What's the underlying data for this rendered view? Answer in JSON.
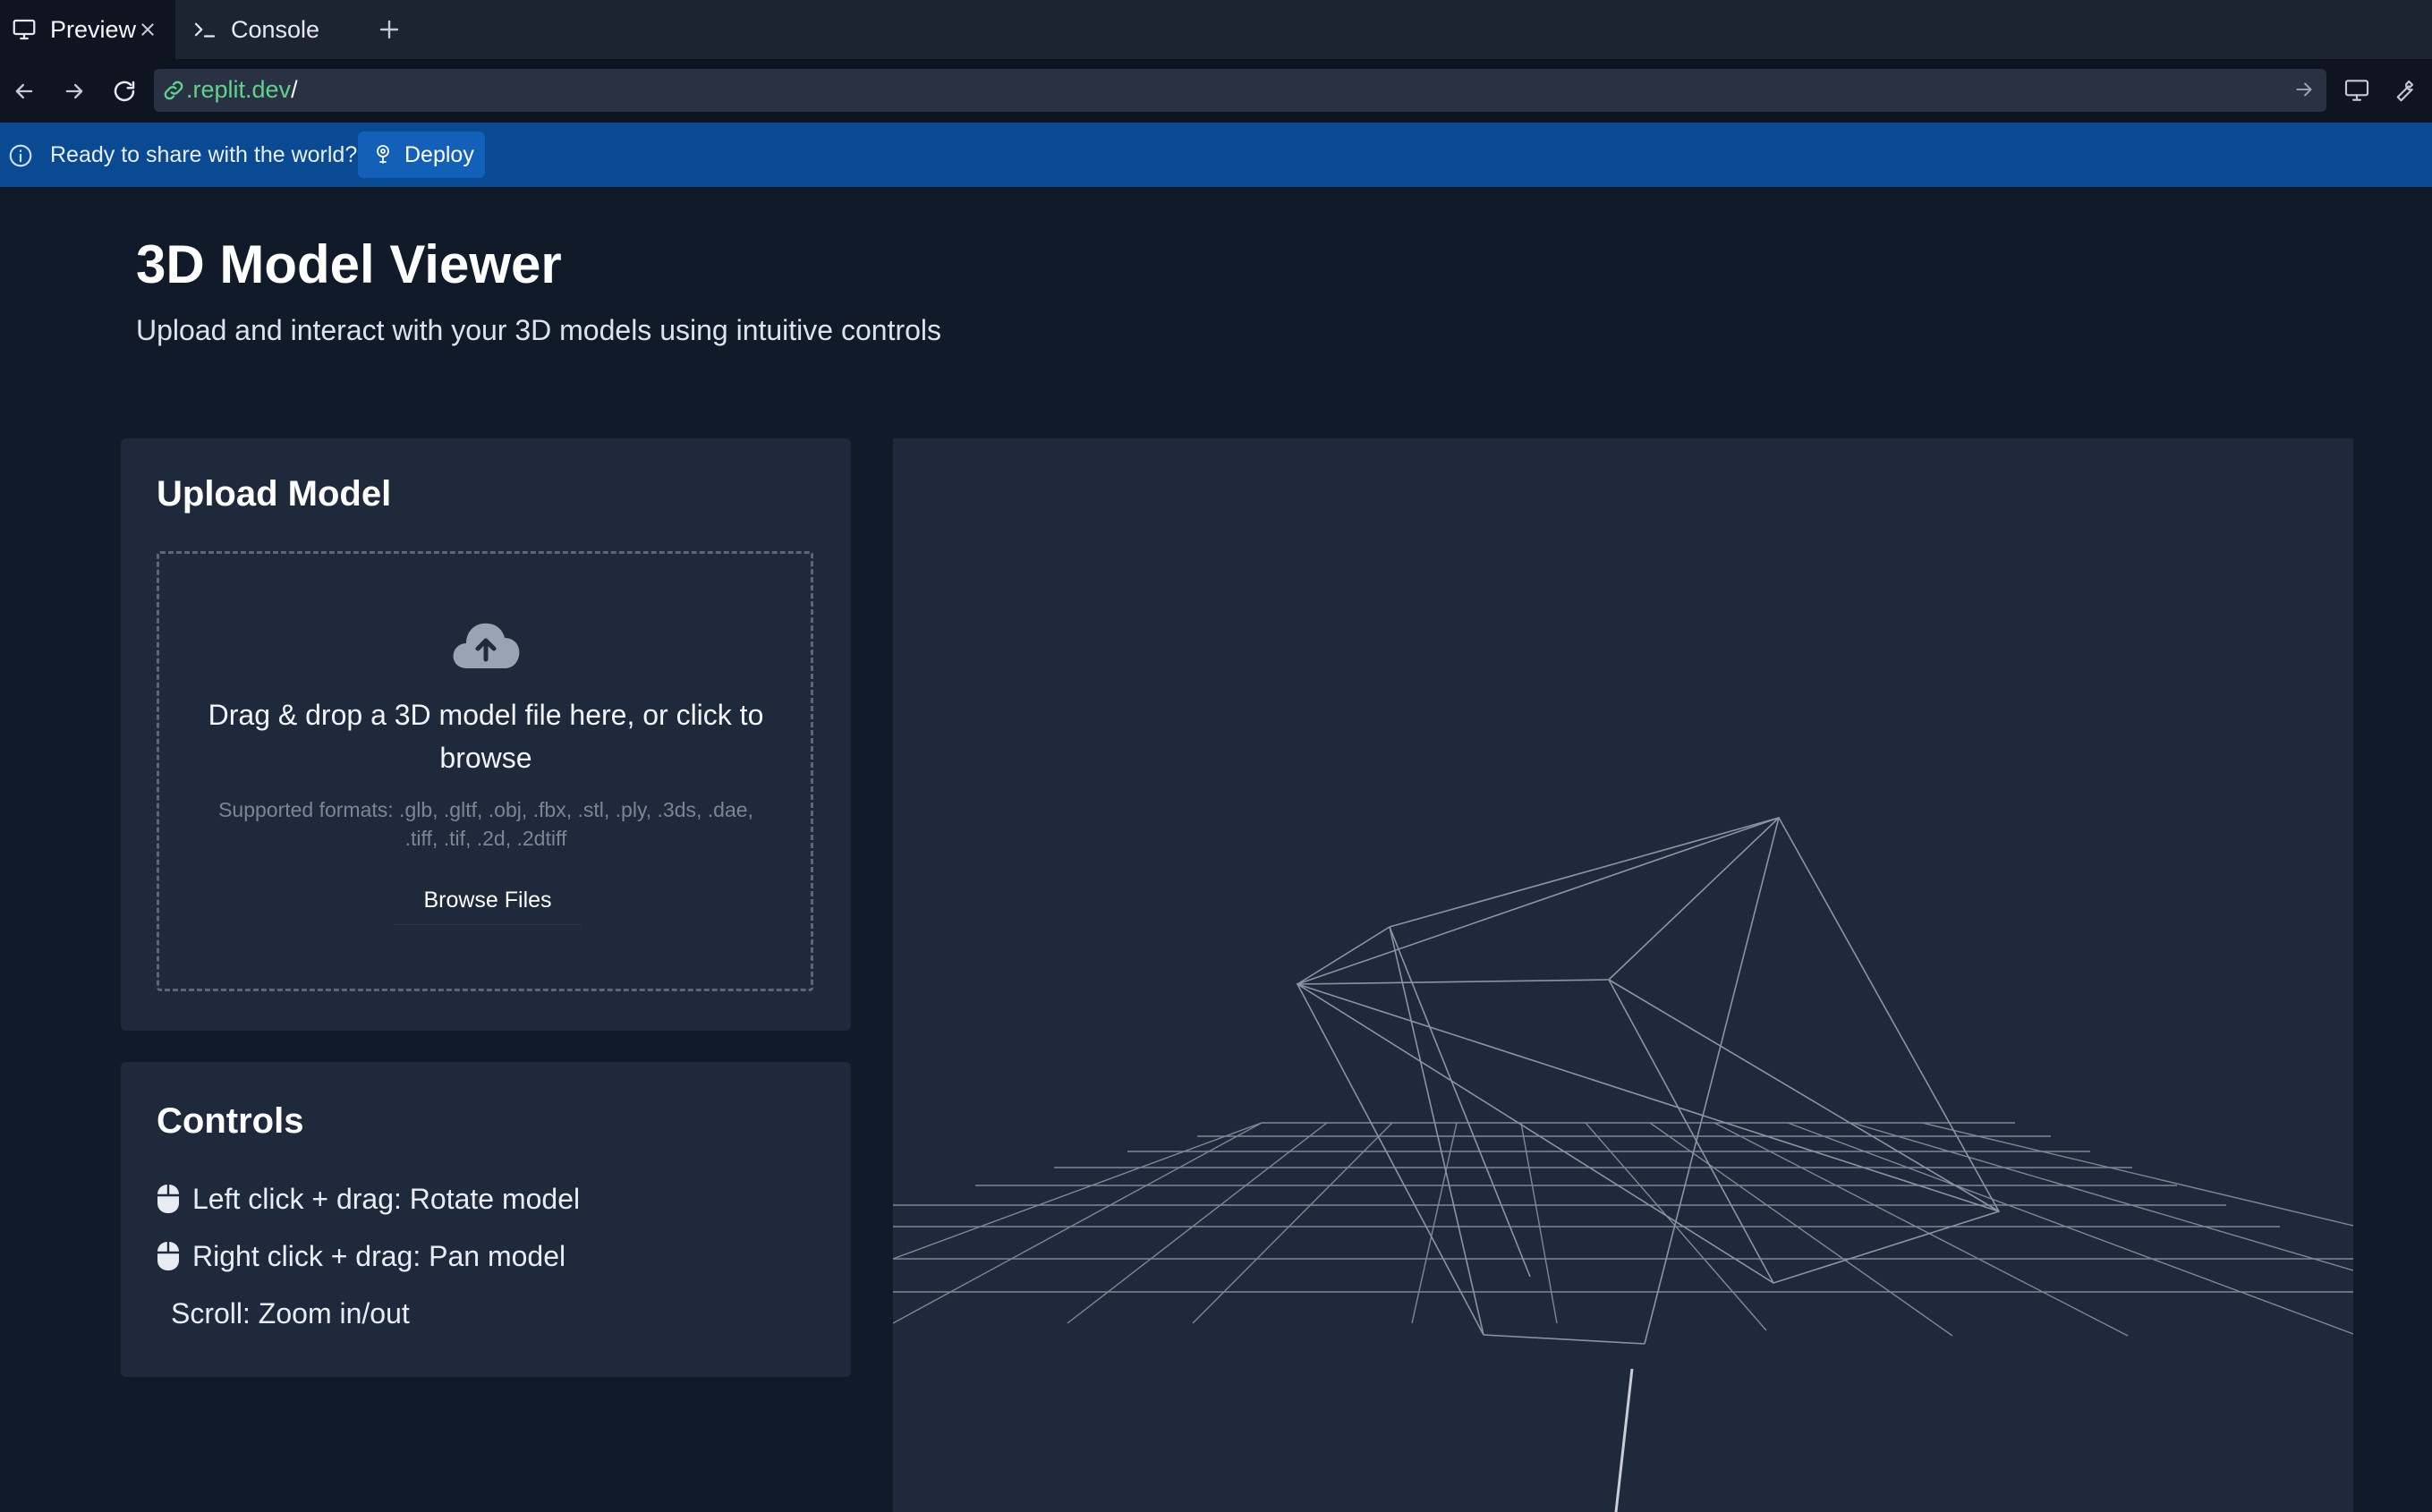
{
  "tabs": [
    {
      "label": "Preview",
      "icon": "monitor-icon",
      "active": true
    },
    {
      "label": "Console",
      "icon": "terminal-icon",
      "active": false
    }
  ],
  "address_bar": {
    "url_host": ".replit.dev",
    "url_path": "/"
  },
  "banner": {
    "message": "Ready to share with the world?",
    "deploy_label": "Deploy"
  },
  "header": {
    "title": "3D Model Viewer",
    "subtitle": "Upload and interact with your 3D models using intuitive controls"
  },
  "upload": {
    "title": "Upload Model",
    "dropzone_text": "Drag & drop a 3D model file here, or click to browse",
    "formats_text": "Supported formats: .glb, .gltf, .obj, .fbx, .stl, .ply, .3ds, .dae, .tiff, .tif, .2d, .2dtiff",
    "browse_label": "Browse Files",
    "icon": "cloud-upload-icon"
  },
  "controls": {
    "title": "Controls",
    "items": [
      {
        "label": "Left click + drag: Rotate model",
        "icon": "mouse-icon"
      },
      {
        "label": "Right click + drag: Pan model",
        "icon": "mouse-icon"
      },
      {
        "label": "Scroll: Zoom in/out",
        "icon": ""
      }
    ]
  },
  "colors": {
    "background": "#111a28",
    "card": "#1e293b",
    "banner": "#0a4a93",
    "deploy_button": "#1360b8",
    "url_host": "#5fd38d",
    "wireframe": "#7f8a99"
  }
}
